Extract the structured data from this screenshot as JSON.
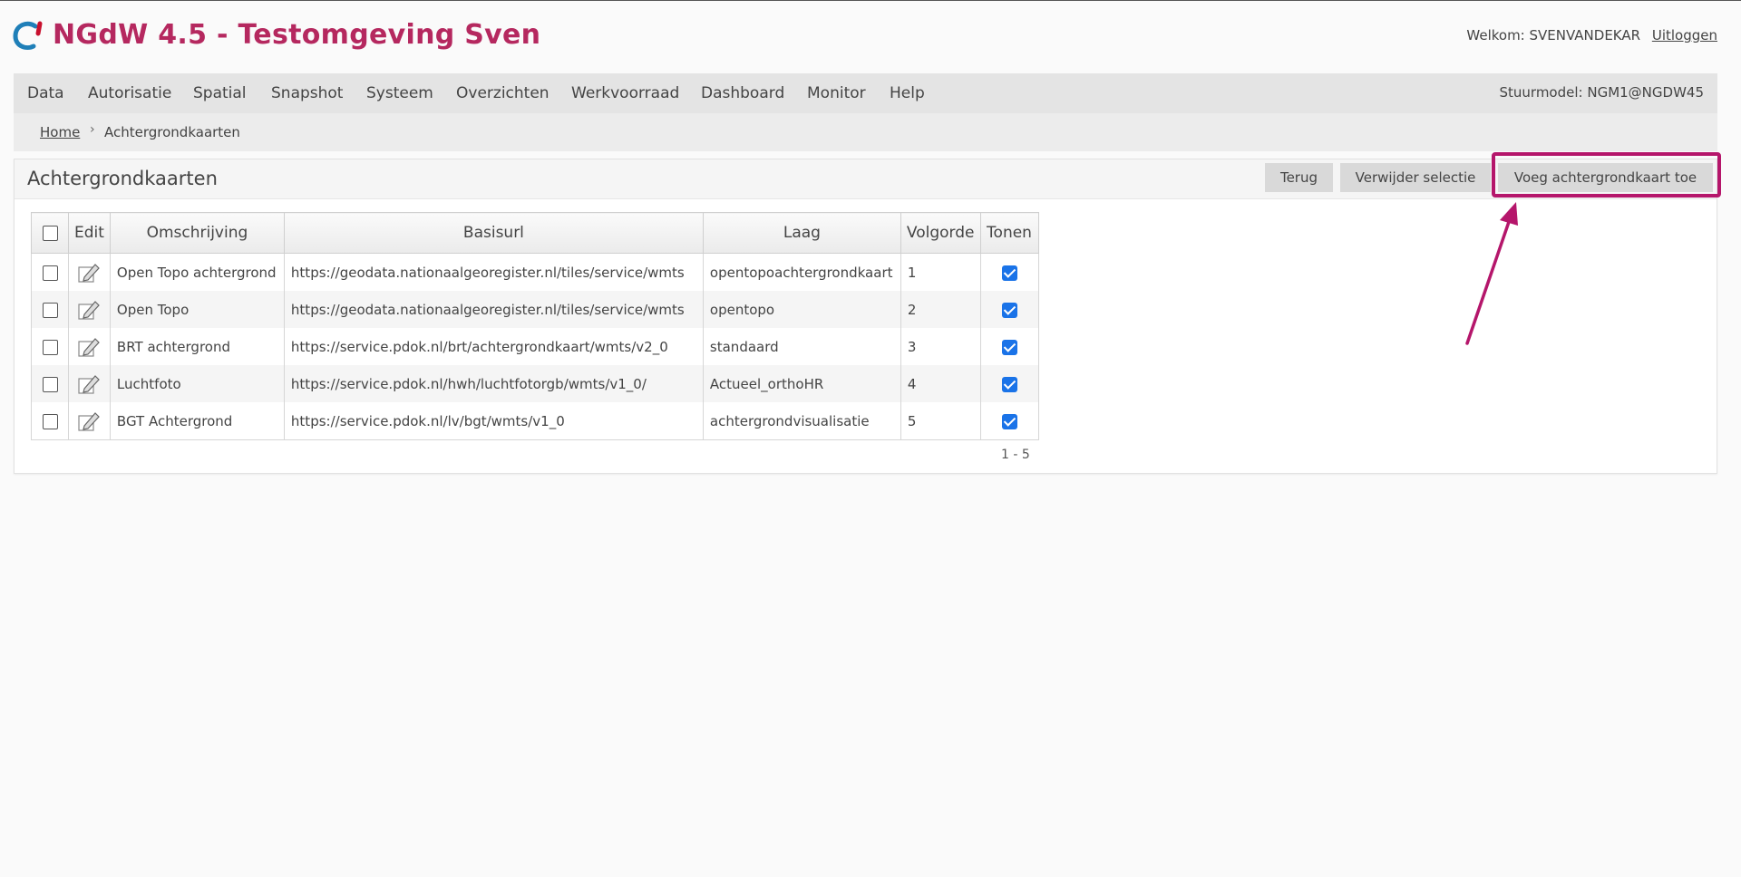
{
  "app": {
    "title": "NGdW 4.5 - Testomgeving Sven",
    "welcome_text": "Welkom: SVENVANDEKAR",
    "logout_label": "Uitloggen",
    "brand_color": "#b5285f"
  },
  "menu": {
    "items": [
      "Data",
      "Autorisatie",
      "Spatial",
      "Snapshot",
      "Systeem",
      "Overzichten",
      "Werkvoorraad",
      "Dashboard",
      "Monitor",
      "Help"
    ],
    "stuurmodel": "Stuurmodel: NGM1@NGDW45"
  },
  "breadcrumb": {
    "home": "Home",
    "separator": "›",
    "current": "Achtergrondkaarten"
  },
  "panel": {
    "title": "Achtergrondkaarten",
    "buttons": {
      "back": "Terug",
      "delete_selection": "Verwijder selectie",
      "add": "Voeg achtergrondkaart toe"
    },
    "highlight_color": "#b5166b"
  },
  "table": {
    "columns": [
      "Edit",
      "Omschrijving",
      "Basisurl",
      "Laag",
      "Volgorde",
      "Tonen"
    ],
    "rows": [
      {
        "omschrijving": "Open Topo achtergrond",
        "basisurl": "https://geodata.nationaalgeoregister.nl/tiles/service/wmts",
        "laag": "opentopoachtergrondkaart",
        "volgorde": "1",
        "tonen": true
      },
      {
        "omschrijving": "Open Topo",
        "basisurl": "https://geodata.nationaalgeoregister.nl/tiles/service/wmts",
        "laag": "opentopo",
        "volgorde": "2",
        "tonen": true
      },
      {
        "omschrijving": "BRT achtergrond",
        "basisurl": "https://service.pdok.nl/brt/achtergrondkaart/wmts/v2_0",
        "laag": "standaard",
        "volgorde": "3",
        "tonen": true
      },
      {
        "omschrijving": "Luchtfoto",
        "basisurl": "https://service.pdok.nl/hwh/luchtfotorgb/wmts/v1_0/",
        "laag": "Actueel_orthoHR",
        "volgorde": "4",
        "tonen": true
      },
      {
        "omschrijving": "BGT Achtergrond",
        "basisurl": "https://service.pdok.nl/lv/bgt/wmts/v1_0",
        "laag": "achtergrondvisualisatie",
        "volgorde": "5",
        "tonen": true
      }
    ],
    "pager": "1 - 5",
    "edit_icon": "pencil-edit-icon"
  }
}
